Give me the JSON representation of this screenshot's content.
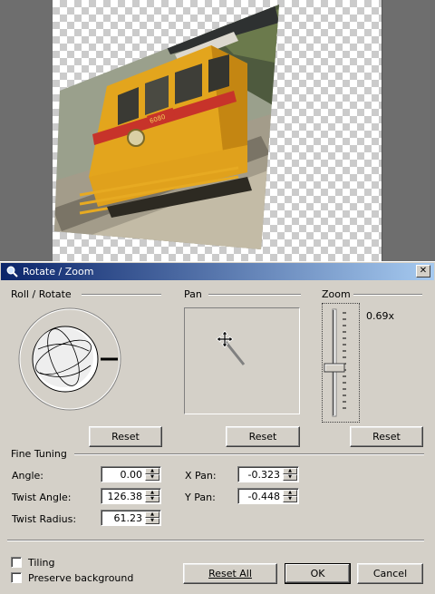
{
  "dialog": {
    "title": "Rotate / Zoom",
    "close_glyph": "✕"
  },
  "roll": {
    "label": "Roll / Rotate",
    "reset_label": "Reset"
  },
  "pan": {
    "label": "Pan",
    "reset_label": "Reset"
  },
  "zoom": {
    "label": "Zoom",
    "value": "0.69x",
    "reset_label": "Reset"
  },
  "fine_tuning": {
    "label": "Fine Tuning",
    "angle_label": "Angle:",
    "angle_value": "0.00",
    "twist_angle_label": "Twist Angle:",
    "twist_angle_value": "126.38",
    "twist_radius_label": "Twist Radius:",
    "twist_radius_value": "61.23",
    "xpan_label": "X Pan:",
    "xpan_value": "-0.323",
    "ypan_label": "Y Pan:",
    "ypan_value": "-0.448"
  },
  "options": {
    "tiling_label": "Tiling",
    "tiling_checked": false,
    "preserve_label": "Preserve background",
    "preserve_checked": false
  },
  "buttons": {
    "reset_all_label": "Reset All",
    "ok_label": "OK",
    "cancel_label": "Cancel"
  },
  "canvas": {
    "image_subject": "yellow tram",
    "tram_number": "6080"
  }
}
